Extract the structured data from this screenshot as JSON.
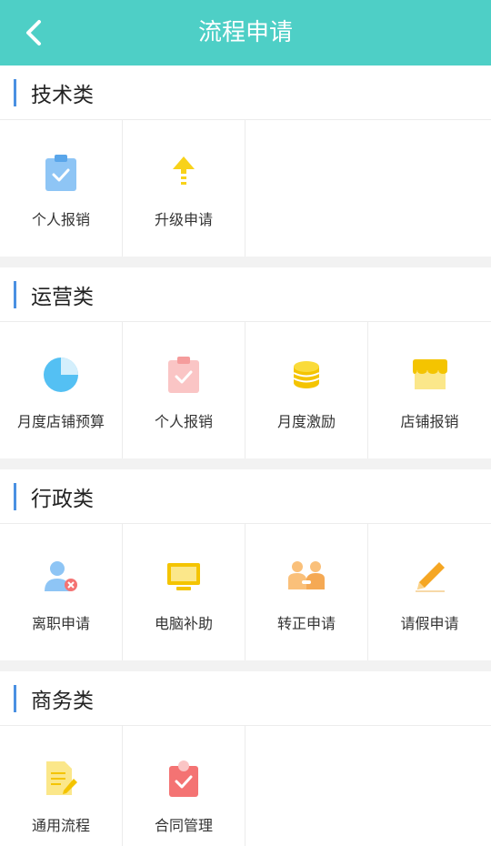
{
  "header": {
    "title": "流程申请",
    "back_icon": "back-chevron-icon"
  },
  "sections": [
    {
      "title": "技术类",
      "items": [
        {
          "label": "个人报销",
          "icon": "clipboard-check-icon"
        },
        {
          "label": "升级申请",
          "icon": "arrow-up-icon"
        }
      ]
    },
    {
      "title": "运营类",
      "items": [
        {
          "label": "月度店铺预算",
          "icon": "pie-chart-icon"
        },
        {
          "label": "个人报销",
          "icon": "clipboard-check-icon"
        },
        {
          "label": "月度激励",
          "icon": "coin-stack-icon"
        },
        {
          "label": "店铺报销",
          "icon": "storefront-icon"
        }
      ]
    },
    {
      "title": "行政类",
      "items": [
        {
          "label": "离职申请",
          "icon": "user-remove-icon"
        },
        {
          "label": "电脑补助",
          "icon": "monitor-icon"
        },
        {
          "label": "转正申请",
          "icon": "handshake-people-icon"
        },
        {
          "label": "请假申请",
          "icon": "pencil-icon"
        }
      ]
    },
    {
      "title": "商务类",
      "items": [
        {
          "label": "通用流程",
          "icon": "document-edit-icon"
        },
        {
          "label": "合同管理",
          "icon": "contract-check-icon"
        }
      ]
    }
  ],
  "colors": {
    "header_bg": "#4ecfc6",
    "section_bar": "#4a90e2"
  }
}
